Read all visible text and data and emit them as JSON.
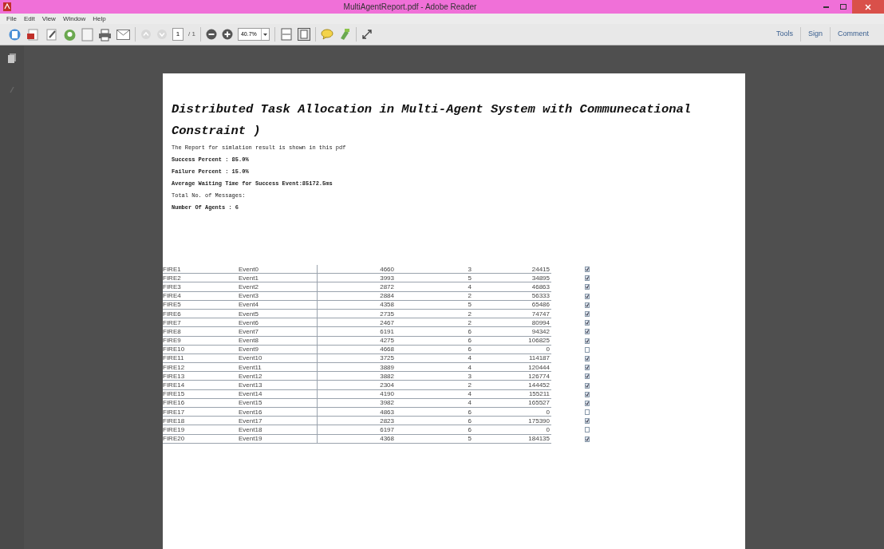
{
  "window": {
    "title": "MultiAgentReport.pdf - Adobe Reader"
  },
  "menu": [
    "File",
    "Edit",
    "View",
    "Window",
    "Help"
  ],
  "toolbar": {
    "page": "1",
    "page_total": "/ 1",
    "zoom": "40.7%",
    "right_buttons": [
      "Tools",
      "Sign",
      "Comment"
    ]
  },
  "document": {
    "title": "Distributed Task Allocation in Multi-Agent System with Communecational Constraint )",
    "lines": [
      "The Report for simlation result is shown in this pdf",
      "Success Percent : 85.0%",
      "Failure Percent : 15.0%",
      "Average Waiting Time for Success Event:85172.5ms",
      "Total No. of Messages:",
      "Number Of Agents : 6"
    ],
    "rows": [
      {
        "c1": "FIRE1",
        "c2": "Event0",
        "c3": "4660",
        "c4": "3",
        "c5": "24415",
        "checked": true
      },
      {
        "c1": "FIRE2",
        "c2": "Event1",
        "c3": "3993",
        "c4": "5",
        "c5": "34895",
        "checked": true
      },
      {
        "c1": "FIRE3",
        "c2": "Event2",
        "c3": "2872",
        "c4": "4",
        "c5": "46863",
        "checked": true
      },
      {
        "c1": "FIRE4",
        "c2": "Event3",
        "c3": "2884",
        "c4": "2",
        "c5": "56333",
        "checked": true
      },
      {
        "c1": "FIRE5",
        "c2": "Event4",
        "c3": "4358",
        "c4": "5",
        "c5": "65486",
        "checked": true
      },
      {
        "c1": "FIRE6",
        "c2": "Event5",
        "c3": "2735",
        "c4": "2",
        "c5": "74747",
        "checked": true
      },
      {
        "c1": "FIRE7",
        "c2": "Event6",
        "c3": "2467",
        "c4": "2",
        "c5": "80994",
        "checked": true
      },
      {
        "c1": "FIRE8",
        "c2": "Event7",
        "c3": "6191",
        "c4": "6",
        "c5": "94342",
        "checked": true
      },
      {
        "c1": "FIRE9",
        "c2": "Event8",
        "c3": "4275",
        "c4": "6",
        "c5": "106825",
        "checked": true
      },
      {
        "c1": "FIRE10",
        "c2": "Event9",
        "c3": "4668",
        "c4": "6",
        "c5": "0",
        "checked": false
      },
      {
        "c1": "FIRE11",
        "c2": "Event10",
        "c3": "3725",
        "c4": "4",
        "c5": "114187",
        "checked": true
      },
      {
        "c1": "FIRE12",
        "c2": "Event11",
        "c3": "3889",
        "c4": "4",
        "c5": "120444",
        "checked": true
      },
      {
        "c1": "FIRE13",
        "c2": "Event12",
        "c3": "3882",
        "c4": "3",
        "c5": "126774",
        "checked": true
      },
      {
        "c1": "FIRE14",
        "c2": "Event13",
        "c3": "2304",
        "c4": "2",
        "c5": "144452",
        "checked": true
      },
      {
        "c1": "FIRE15",
        "c2": "Event14",
        "c3": "4190",
        "c4": "4",
        "c5": "155211",
        "checked": true
      },
      {
        "c1": "FIRE16",
        "c2": "Event15",
        "c3": "3982",
        "c4": "4",
        "c5": "165527",
        "checked": true
      },
      {
        "c1": "FIRE17",
        "c2": "Event16",
        "c3": "4863",
        "c4": "6",
        "c5": "0",
        "checked": false
      },
      {
        "c1": "FIRE18",
        "c2": "Event17",
        "c3": "2823",
        "c4": "6",
        "c5": "175390",
        "checked": true
      },
      {
        "c1": "FIRE19",
        "c2": "Event18",
        "c3": "6197",
        "c4": "6",
        "c5": "0",
        "checked": false
      },
      {
        "c1": "FIRE20",
        "c2": "Event19",
        "c3": "4368",
        "c4": "5",
        "c5": "184135",
        "checked": true
      }
    ]
  }
}
